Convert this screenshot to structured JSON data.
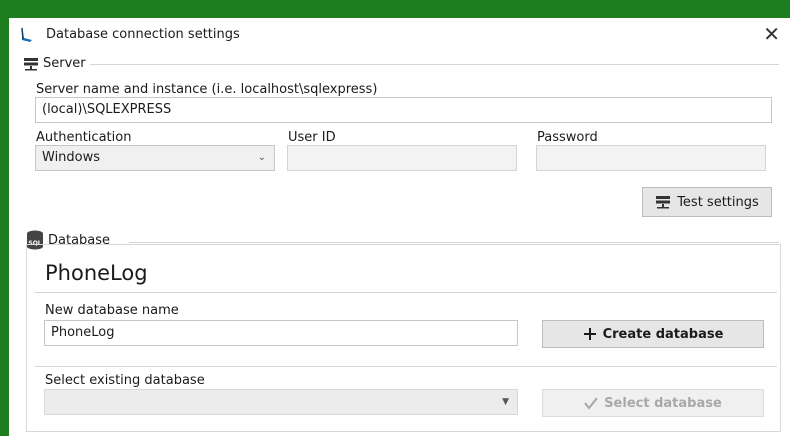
{
  "window": {
    "title": "Database connection settings",
    "close_glyph": "✕",
    "app_icon": "feather-icon"
  },
  "server": {
    "group_label": "Server",
    "group_icon": "server-icon",
    "instance_label": "Server name and instance (i.e. localhost\\sqlexpress)",
    "instance_value": "(local)\\SQLEXPRESS",
    "auth_label": "Authentication",
    "auth_value": "Windows",
    "userid_label": "User ID",
    "userid_value": "",
    "password_label": "Password",
    "password_value": "",
    "test_button": "Test settings"
  },
  "database": {
    "group_label": "Database",
    "group_icon": "sql-database-icon",
    "current_name": "PhoneLog",
    "new_label": "New database name",
    "new_value": "PhoneLog",
    "create_button": "Create database",
    "existing_label": "Select existing database",
    "existing_value": "",
    "select_button": "Select database"
  },
  "colors": {
    "frame_border": "#1e7d1e",
    "button_bg": "#e6e6e6"
  }
}
